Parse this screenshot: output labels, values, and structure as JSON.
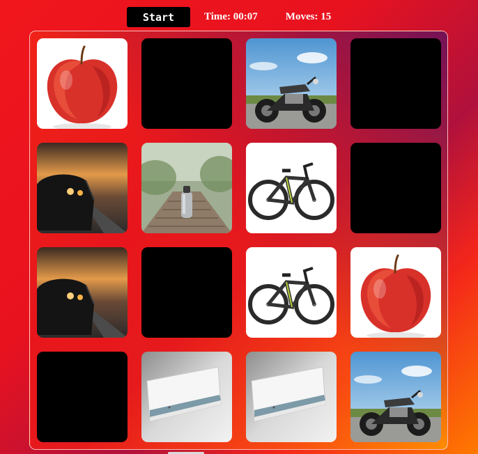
{
  "controls": {
    "start_label": "Start",
    "time_text": "Time: 00:07",
    "moves_text": "Moves: 15"
  },
  "board": {
    "rows": 4,
    "cols": 4,
    "cards": [
      {
        "row": 0,
        "col": 0,
        "state": "revealed",
        "image": "apple"
      },
      {
        "row": 0,
        "col": 1,
        "state": "hidden",
        "image": ""
      },
      {
        "row": 0,
        "col": 2,
        "state": "revealed",
        "image": "motorcycle"
      },
      {
        "row": 0,
        "col": 3,
        "state": "hidden",
        "image": ""
      },
      {
        "row": 1,
        "col": 0,
        "state": "revealed",
        "image": "car"
      },
      {
        "row": 1,
        "col": 1,
        "state": "revealed",
        "image": "water-bottle"
      },
      {
        "row": 1,
        "col": 2,
        "state": "revealed",
        "image": "bicycle"
      },
      {
        "row": 1,
        "col": 3,
        "state": "hidden",
        "image": ""
      },
      {
        "row": 2,
        "col": 0,
        "state": "revealed",
        "image": "car"
      },
      {
        "row": 2,
        "col": 1,
        "state": "hidden",
        "image": ""
      },
      {
        "row": 2,
        "col": 2,
        "state": "revealed",
        "image": "bicycle"
      },
      {
        "row": 2,
        "col": 3,
        "state": "revealed",
        "image": "apple"
      },
      {
        "row": 3,
        "col": 0,
        "state": "hidden",
        "image": ""
      },
      {
        "row": 3,
        "col": 1,
        "state": "revealed",
        "image": "air-conditioner"
      },
      {
        "row": 3,
        "col": 2,
        "state": "revealed",
        "image": "air-conditioner"
      },
      {
        "row": 3,
        "col": 3,
        "state": "revealed",
        "image": "motorcycle"
      }
    ]
  },
  "colors": {
    "card_back": "#000000",
    "accent_text": "#ffffff"
  }
}
